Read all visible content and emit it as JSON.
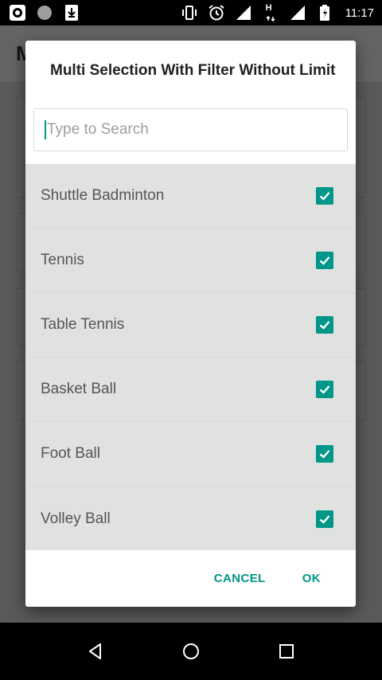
{
  "status_bar": {
    "time": "11:17",
    "network_label": "H",
    "left_icons": [
      "record-icon",
      "circle-icon",
      "download-icon"
    ],
    "right_icons": [
      "vibrate-icon",
      "alarm-icon",
      "signal-icon",
      "signal-h-icon",
      "battery-icon"
    ]
  },
  "background_app": {
    "title_initial": "M"
  },
  "dialog": {
    "title": "Multi Selection With Filter Without Limit",
    "search_placeholder": "Type to Search",
    "search_value": "",
    "items": [
      {
        "label": "Shuttle Badminton",
        "checked": true
      },
      {
        "label": "Tennis",
        "checked": true
      },
      {
        "label": "Table Tennis",
        "checked": true
      },
      {
        "label": "Basket Ball",
        "checked": true
      },
      {
        "label": "Foot Ball",
        "checked": true
      },
      {
        "label": "Volley Ball",
        "checked": true
      }
    ],
    "cancel_label": "CANCEL",
    "ok_label": "OK"
  },
  "colors": {
    "accent": "#009688",
    "list_background": "#e0e2e1"
  },
  "nav_bar": {
    "icons": [
      "back-icon",
      "home-icon",
      "recents-icon"
    ]
  }
}
